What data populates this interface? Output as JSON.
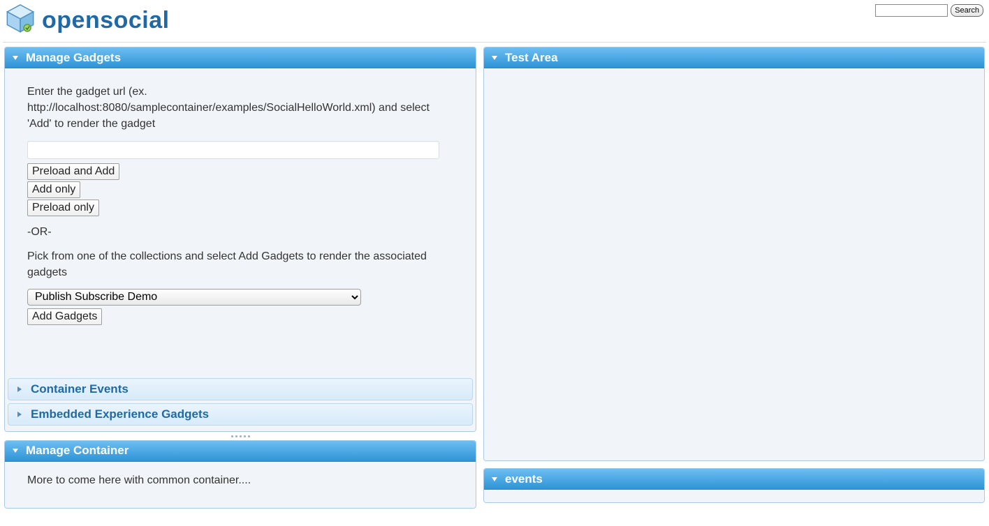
{
  "topbar": {
    "search_placeholder": "",
    "search_button": "Search"
  },
  "brand": {
    "name": "opensocial"
  },
  "left": {
    "manage_gadgets": {
      "title": "Manage Gadgets",
      "intro": "Enter the gadget url (ex. http://localhost:8080/samplecontainer/examples/SocialHelloWorld.xml) and select 'Add' to render the gadget",
      "url_value": "",
      "preload_add": "Preload and Add",
      "add_only": "Add only",
      "preload_only": "Preload only",
      "or_label": "-OR-",
      "pick_text": "Pick from one of the collections and select Add Gadgets to render the associated gadgets",
      "select_value": "Publish Subscribe Demo",
      "add_gadgets": "Add Gadgets"
    },
    "accordion": {
      "container_events": "Container Events",
      "ee_gadgets": "Embedded Experience Gadgets"
    },
    "manage_container": {
      "title": "Manage Container",
      "text": "More to come here with common container...."
    }
  },
  "right": {
    "test_area": {
      "title": "Test Area"
    },
    "events": {
      "title": "events"
    }
  }
}
